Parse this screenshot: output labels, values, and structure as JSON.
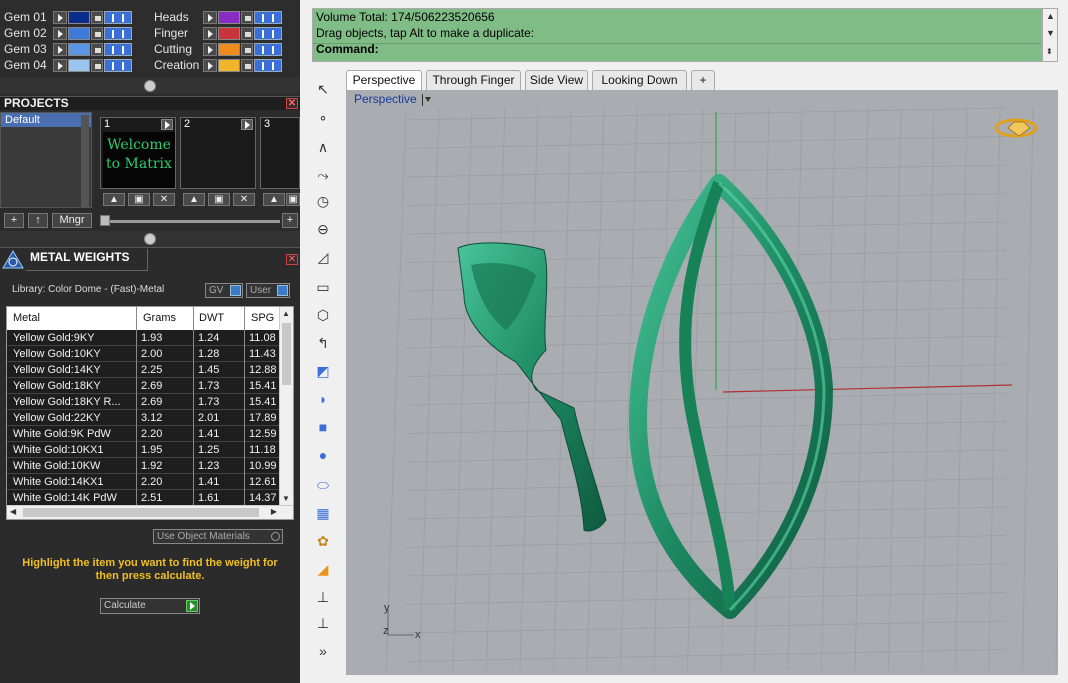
{
  "layers": {
    "left": [
      {
        "name": "Gem 01",
        "color": "#0a2d8c"
      },
      {
        "name": "Gem 02",
        "color": "#3e7ad8"
      },
      {
        "name": "Gem 03",
        "color": "#5a95e6"
      },
      {
        "name": "Gem 04",
        "color": "#9cc4f0"
      }
    ],
    "right": [
      {
        "name": "Heads",
        "color": "#8a2bc8"
      },
      {
        "name": "Finger",
        "color": "#c8343a"
      },
      {
        "name": "Cutting",
        "color": "#f08b1e"
      },
      {
        "name": "Creation",
        "color": "#f0b52a"
      }
    ]
  },
  "projects": {
    "title": "PROJECTS",
    "list": [
      "Default"
    ],
    "slots": [
      {
        "num": "1",
        "thumb": "Welcome to Matrix"
      },
      {
        "num": "2",
        "thumb": ""
      },
      {
        "num": "3",
        "thumb": ""
      }
    ],
    "buttons": {
      "add": "+",
      "up": "↑",
      "manager": "Mngr",
      "plus": "+"
    }
  },
  "metal_weights": {
    "title": "METAL WEIGHTS",
    "library": "Library: Color Dome - (Fast)-Metal",
    "gv_label": "GV",
    "user_label": "User",
    "columns": [
      "Metal",
      "Grams",
      "DWT",
      "SPG"
    ],
    "rows": [
      [
        "Yellow Gold:9KY",
        "1.93",
        "1.24",
        "11.08"
      ],
      [
        "Yellow Gold:10KY",
        "2.00",
        "1.28",
        "11.43"
      ],
      [
        "Yellow Gold:14KY",
        "2.25",
        "1.45",
        "12.88"
      ],
      [
        "Yellow Gold:18KY",
        "2.69",
        "1.73",
        "15.41"
      ],
      [
        "Yellow Gold:18KY R...",
        "2.69",
        "1.73",
        "15.41"
      ],
      [
        "Yellow Gold:22KY",
        "3.12",
        "2.01",
        "17.89"
      ],
      [
        "White Gold:9K PdW",
        "2.20",
        "1.41",
        "12.59"
      ],
      [
        "White Gold:10KX1",
        "1.95",
        "1.25",
        "11.18"
      ],
      [
        "White Gold:10KW",
        "1.92",
        "1.23",
        "10.99"
      ],
      [
        "White Gold:14KX1",
        "2.20",
        "1.41",
        "12.61"
      ],
      [
        "White Gold:14K PdW",
        "2.51",
        "1.61",
        "14.37"
      ]
    ],
    "use_object_materials": "Use Object Materials",
    "hint": "Highlight the item you want to find the weight for then press calculate.",
    "calculate": "Calculate"
  },
  "command": {
    "line1": "Volume Total: 174/506223520656",
    "line2": "Drag objects, tap Alt to make a duplicate:",
    "line3": "Command:"
  },
  "viewport": {
    "tabs": [
      "Perspective",
      "Through Finger",
      "Side View",
      "Looking Down",
      "+"
    ],
    "label": "Perspective",
    "axis_y": "y",
    "axis_z": "z",
    "axis_x": "x",
    "more": "»"
  }
}
